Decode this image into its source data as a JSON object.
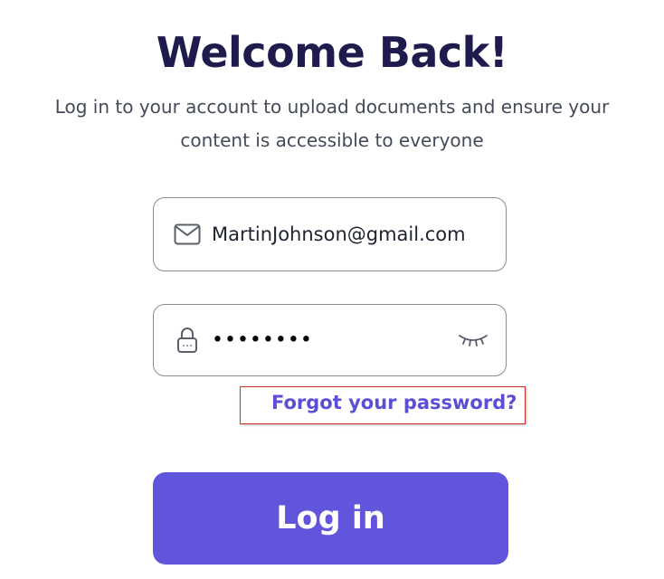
{
  "heading": {
    "title": "Welcome Back!",
    "subtitle": "Log in to your account to upload documents and ensure your content is accessible to everyone"
  },
  "form": {
    "email": {
      "value": "MartinJohnson@gmail.com",
      "icon": "mail-icon"
    },
    "password": {
      "masked_value": "••••••••",
      "icon": "lock-icon",
      "toggle_icon": "eye-closed-icon"
    },
    "forgot_password_label": "Forgot your password?",
    "submit_label": "Log in"
  },
  "colors": {
    "title": "#1f1b4d",
    "accent": "#6155dc",
    "link": "#5b4fd6",
    "highlight_box": "#d42a2a"
  }
}
